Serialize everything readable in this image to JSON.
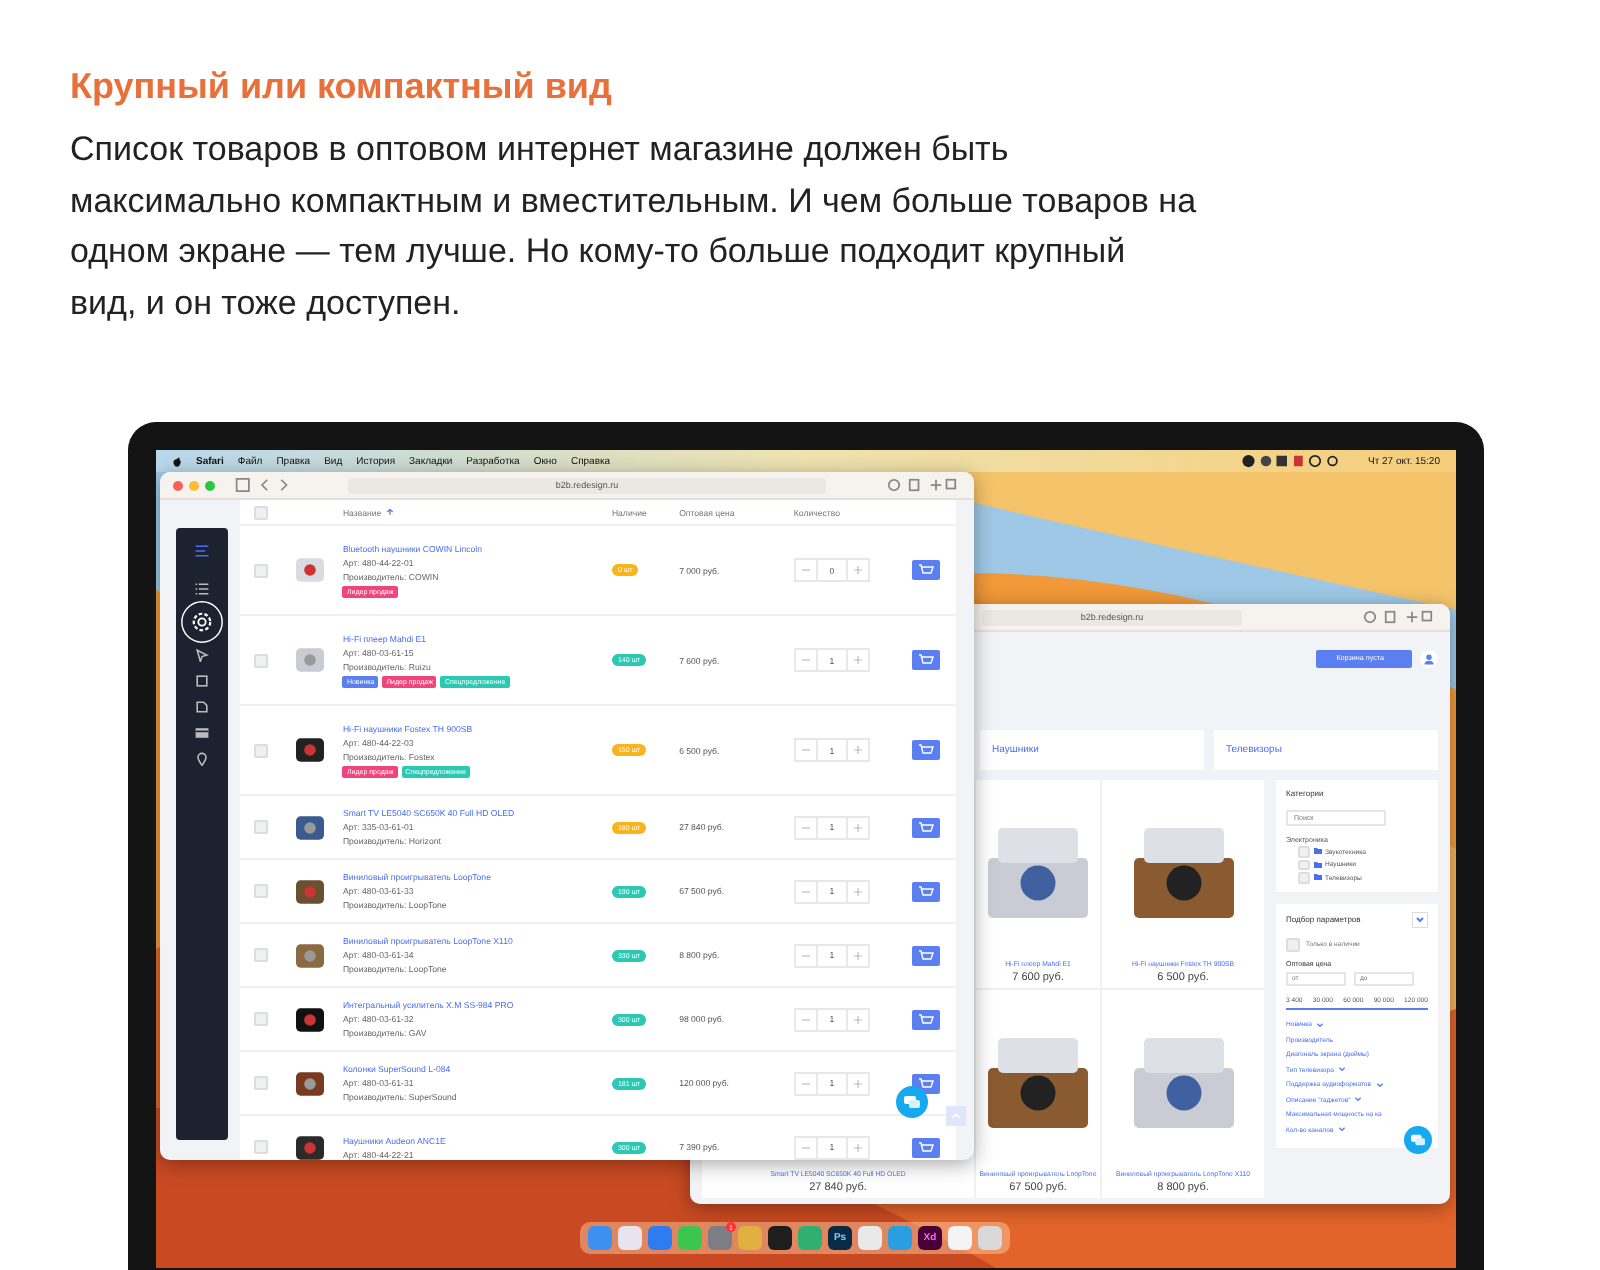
{
  "heading": "Крупный или компактный вид",
  "description": "Список товаров в оптовом интернет магазине должен быть максимально компактным и вместительным. И чем больше товаров на одном экране — тем лучше. Но кому-то больше подходит крупный вид, и он тоже доступен.",
  "menubar": {
    "app": "Safari",
    "items": [
      "Файл",
      "Правка",
      "Вид",
      "История",
      "Закладки",
      "Разработка",
      "Окно",
      "Справка"
    ],
    "clock": "Чт 27 окт. 15:20"
  },
  "front_window": {
    "url": "b2b.redesign.ru",
    "select_all_checked": false,
    "columns": [
      "Название",
      "Наличие",
      "Оптовая цена",
      "Количество"
    ],
    "rows": [
      {
        "name": "Bluetooth наушники COWIN Lincoln",
        "sku": "Арт: 480-44-22-01",
        "maker": "Производитель: COWIN",
        "tags": [
          {
            "label": "Лидер продаж",
            "color": "#f0447c"
          }
        ],
        "stock": {
          "label": "0 шт",
          "color": "#f8b41c"
        },
        "price": "7 000 руб.",
        "qty": "0",
        "checked": false
      },
      {
        "name": "Hi-Fi плеер Mahdi E1",
        "sku": "Арт: 480-03-61-15",
        "maker": "Производитель: Ruizu",
        "tags": [
          {
            "label": "Новинка",
            "color": "#5b7ef0"
          },
          {
            "label": "Лидер продаж",
            "color": "#f0447c"
          },
          {
            "label": "Спецпредложение",
            "color": "#2bc9b4"
          }
        ],
        "stock": {
          "label": "140 шт",
          "color": "#2bc9b4"
        },
        "price": "7 600 руб.",
        "qty": "1",
        "checked": false
      },
      {
        "name": "Hi-Fi наушники Fostex TH 900SB",
        "sku": "Арт: 480-44-22-03",
        "maker": "Производитель: Fostex",
        "tags": [
          {
            "label": "Лидер продаж",
            "color": "#f0447c"
          },
          {
            "label": "Спецпредложение",
            "color": "#2bc9b4"
          }
        ],
        "stock": {
          "label": "150 шт",
          "color": "#f8b41c"
        },
        "price": "6 500 руб.",
        "qty": "1",
        "checked": false
      },
      {
        "name": "Smart TV LE5040 SC650K 40 Full HD OLED",
        "sku": "Арт: 335-03-61-01",
        "maker": "Производитель: Horizont",
        "tags": [],
        "stock": {
          "label": "180 шт",
          "color": "#f8b41c"
        },
        "price": "27 840 руб.",
        "qty": "1",
        "checked": false
      },
      {
        "name": "Виниловый проигрыватель LoopTone",
        "sku": "Арт: 480-03-61-33",
        "maker": "Производитель: LoopTone",
        "tags": [],
        "stock": {
          "label": "190 шт",
          "color": "#2bc9b4"
        },
        "price": "67 500 руб.",
        "qty": "1",
        "checked": false
      },
      {
        "name": "Виниловый проигрыватель LoopTone X110",
        "sku": "Арт: 480-03-61-34",
        "maker": "Производитель: LoopTone",
        "tags": [],
        "stock": {
          "label": "330 шт",
          "color": "#2bc9b4"
        },
        "price": "8 800 руб.",
        "qty": "1",
        "checked": false
      },
      {
        "name": "Интегральный усилитель X.M SS-984 PRO",
        "sku": "Арт: 480-03-61-32",
        "maker": "Производитель: GAV",
        "tags": [],
        "stock": {
          "label": "300 шт",
          "color": "#2bc9b4"
        },
        "price": "98 000 руб.",
        "qty": "1",
        "checked": false
      },
      {
        "name": "Колонки SuperSound L-084",
        "sku": "Арт: 480-03-61-31",
        "maker": "Производитель: SuperSound",
        "tags": [],
        "stock": {
          "label": "181 шт",
          "color": "#2bc9b4"
        },
        "price": "120 000 руб.",
        "qty": "1",
        "checked": false
      },
      {
        "name": "Наушники Audeon ANC1E",
        "sku": "Арт: 480-44-22-21",
        "tags": [],
        "stock": {
          "label": "300 шт",
          "color": "#2bc9b4"
        },
        "price": "7 390 руб.",
        "qty": "1",
        "checked": false
      }
    ]
  },
  "back_window": {
    "url": "b2b.redesign.ru",
    "cart_button": "Корзина пуста",
    "categories": [
      "Наушники",
      "Телевизоры"
    ],
    "products": [
      {
        "name": "Hi-Fi плеер Mahdi E1",
        "price": "7 600 руб."
      },
      {
        "name": "Hi-Fi наушники Fostex TH 900SB",
        "price": "6 500 руб."
      },
      {
        "name": "Smart TV LE5040 SC650K 40 Full HD OLED",
        "price": "27 840 руб."
      },
      {
        "name": "Виниловый проигрыватель LoopTone",
        "price": "67 500 руб."
      },
      {
        "name": "Виниловый проигрыватель LoopTone X110",
        "price": "8 800 руб."
      }
    ],
    "categories_panel": {
      "title": "Категории",
      "search": {
        "placeholder": "Поиск"
      },
      "tree": [
        {
          "label": "Электроника",
          "children": [
            {
              "label": "Звукотехника",
              "checked": false
            },
            {
              "label": "Наушники",
              "checked": false
            },
            {
              "label": "Телевизоры",
              "checked": false
            }
          ]
        }
      ]
    },
    "filters": {
      "title": "Подбор параметров",
      "in_stock": {
        "label": "Только в наличии",
        "checked": false
      },
      "price_label": "Оптовая цена",
      "from": {
        "placeholder": "от"
      },
      "to": {
        "placeholder": "до"
      },
      "ticks": [
        "3 400",
        "30 000",
        "60 000",
        "90 000",
        "120 000"
      ],
      "range": {
        "level": 1
      },
      "links": [
        {
          "label": "Новинка",
          "kind": "dropdown"
        },
        {
          "label": "Производитель",
          "kind": "link"
        },
        {
          "label": "Диагональ экрана (дюймы)",
          "kind": "link"
        },
        {
          "label": "Тип телевизора",
          "kind": "dropdown"
        },
        {
          "label": "Поддержка аудиоформатов",
          "kind": "dropdown"
        },
        {
          "label": "Описание \"гаджетов\"",
          "kind": "dropdown"
        },
        {
          "label": "Максимальная мощность на ка",
          "kind": "link"
        },
        {
          "label": "Кол-во каналов",
          "kind": "dropdown"
        }
      ]
    }
  },
  "dock": [
    {
      "color": "#3d8ff0"
    },
    {
      "color": "#e8e4ee"
    },
    {
      "color": "#2f7cf0"
    },
    {
      "color": "#3cc650"
    },
    {
      "color": "#7d7d85",
      "badge": "1"
    },
    {
      "color": "#e0b040"
    },
    {
      "color": "#1e1e1e"
    },
    {
      "color": "#30b070"
    },
    {
      "color": "#0a2a45",
      "label": "Ps"
    },
    {
      "color": "#e9e9e9"
    },
    {
      "color": "#2a9ee0"
    },
    {
      "color": "#470137",
      "label": "Xd"
    },
    {
      "color": "#f4f4f4"
    },
    {
      "color": "#d8d8d8"
    }
  ]
}
